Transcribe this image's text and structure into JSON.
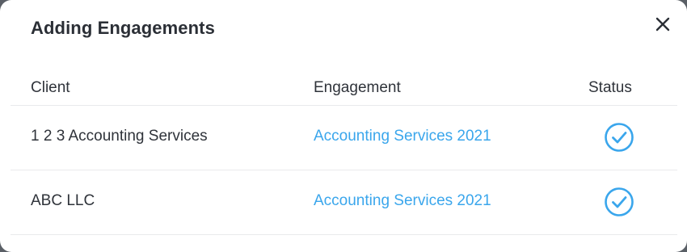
{
  "modal": {
    "title": "Adding Engagements",
    "close_icon": "close-icon"
  },
  "table": {
    "columns": [
      "Client",
      "Engagement",
      "Status"
    ],
    "rows": [
      {
        "client": "1 2 3 Accounting Services",
        "engagement": "Accounting Services 2021",
        "status_icon": "check-circle-icon"
      },
      {
        "client": "ABC LLC",
        "engagement": "Accounting Services 2021",
        "status_icon": "check-circle-icon"
      }
    ]
  },
  "colors": {
    "link": "#3aa6ec",
    "status_check": "#3aa6ec",
    "text": "#2f333a",
    "divider": "#e9eaec"
  }
}
